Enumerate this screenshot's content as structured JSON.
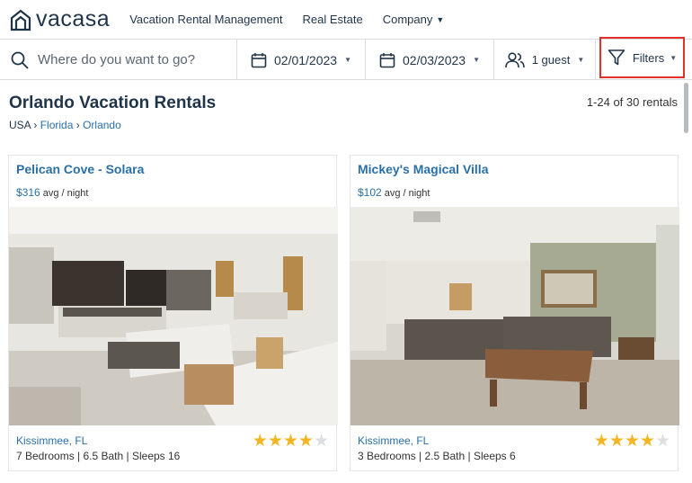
{
  "brand": {
    "name": "vacasa"
  },
  "nav": {
    "items": [
      "Vacation Rental Management",
      "Real Estate",
      "Company"
    ]
  },
  "search": {
    "placeholder": "Where do you want to go?",
    "check_in": "02/01/2023",
    "check_out": "02/03/2023",
    "guests": "1 guest",
    "filters": "Filters"
  },
  "page": {
    "title": "Orlando Vacation Rentals",
    "result_count": "1-24 of 30 rentals",
    "breadcrumb": [
      "USA",
      "Florida",
      "Orlando"
    ]
  },
  "listings": [
    {
      "name": "Pelican Cove - Solara",
      "price": "$316",
      "price_unit": "avg / night",
      "location": "Kissimmee, FL",
      "details": "7 Bedrooms | 6.5 Bath | Sleeps 16",
      "rating": 4
    },
    {
      "name": "Mickey's Magical Villa",
      "price": "$102",
      "price_unit": "avg / night",
      "location": "Kissimmee, FL",
      "details": "3 Bedrooms | 2.5 Bath | Sleeps 6",
      "rating": 4
    }
  ],
  "colors": {
    "brand": "#1f3349",
    "link": "#2a6fa6",
    "star": "#f2b523",
    "highlight": "#e0302b"
  },
  "icons": [
    "home-logo-icon",
    "search-icon",
    "calendar-icon",
    "users-icon",
    "filter-icon",
    "caret-down-icon",
    "star-icon"
  ]
}
